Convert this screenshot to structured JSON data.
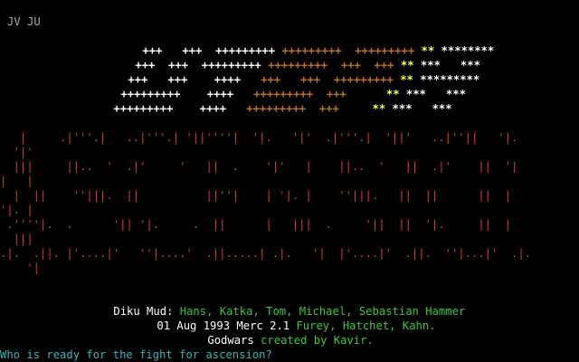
{
  "top_marker": "JV JU",
  "banner": [
    {
      "offset": "     ",
      "w1": "+++   +++  +++++++++ ",
      "o1": "+++++++++  +++++++++ ",
      "y1": "**",
      "w2": " ********"
    },
    {
      "offset": "      ",
      "w1": "+++  +++  +++++++++ ",
      "o1": "+++++++++  +++  +++ ",
      "y1": "**",
      "w2": " ***   ***"
    },
    {
      "offset": "     ",
      "w1": "+++   +++    ++++   ",
      "o1": "+++   +++  +++++++++ ",
      "y1": "**",
      "w2": " *********"
    },
    {
      "offset": "    ",
      "w1": "+++++++++    ++++   ",
      "o1": "+++++++++  +++      ",
      "y1": "**",
      "w2": " ***   ***"
    },
    {
      "offset": "    ",
      "w1": "+++++++++    ++++   ",
      "o1": "+++++++++  +++     ",
      "y1": "**",
      "w2": " ***   ***"
    }
  ],
  "ascii_art": [
    "   |     .|'''.|   ..|'''.| '||''''|  '|.   '|'  .|'''.|  '||'   ..|''||   '|.",
    "  '|'                                                                        ",
    "  |||     ||..  '  .|'     '   ||  .    '|'   |    ||..  '   ||  .|'    ||  '|",
    "|   |                                                                        ",
    "  |  ||    ''|||.  ||          ||''|    | '|. |    ''|||.   ||  ||      ||  |",
    "'|. |                                                                        ",
    " .''''|.  .      '|| '|.     .  ||      |   |||  .     '||  ||  '|.     ||  |",
    "  |||                                                                         ",
    ".|.  .||. |'....|'   ''|....'  .||.....| .|.   '|  |'....|'  .||.  ''|...|'  .|.",
    "    '|                                                                       "
  ],
  "credits": {
    "line1_label": "Diku Mud: ",
    "line1_names": "Hans, Katka, Tom, Michael, Sebastian Hammer",
    "line2_label": "01 Aug 1993 Merc 2.1 ",
    "line2_names": "Furey, Hatchet, Kahn.",
    "line3_label": "Godwars ",
    "line3_created": "created by ",
    "line3_author": "Kavir."
  },
  "prompt": "Who is ready for the fight for ascension?"
}
